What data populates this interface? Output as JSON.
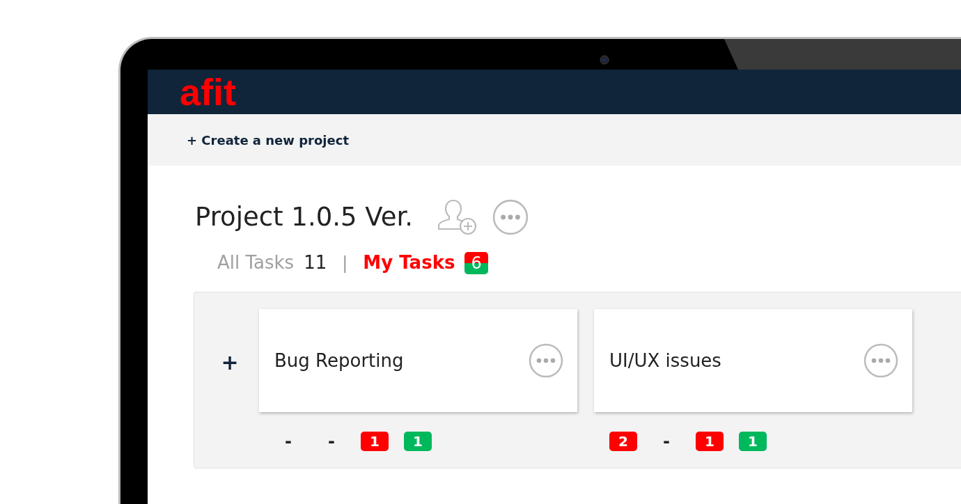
{
  "header": {
    "logo": "afit"
  },
  "toolbar": {
    "create_link": "+ Create a new project"
  },
  "project": {
    "title": "Project 1.0.5 Ver."
  },
  "tabs": [
    {
      "label": "All Tasks",
      "count": "11",
      "selected": false
    },
    {
      "label": "My Tasks",
      "count": "6",
      "selected": true
    }
  ],
  "tab_separator": "|",
  "board": {
    "add_button": "+",
    "lists": [
      {
        "title": "Bug Reporting",
        "counters": [
          {
            "kind": "dash",
            "text": "-"
          },
          {
            "kind": "dash",
            "text": "-"
          },
          {
            "kind": "count",
            "text": "1",
            "color": "#ff0000"
          },
          {
            "kind": "count",
            "text": "1",
            "color": "#00b85c"
          }
        ]
      },
      {
        "title": "UI/UX issues",
        "counters": [
          {
            "kind": "count",
            "text": "2",
            "color": "#ff0000"
          },
          {
            "kind": "dash",
            "text": "-"
          },
          {
            "kind": "count",
            "text": "1",
            "color": "#ff0000"
          },
          {
            "kind": "count",
            "text": "1",
            "color": "#00b85c"
          }
        ]
      }
    ]
  }
}
